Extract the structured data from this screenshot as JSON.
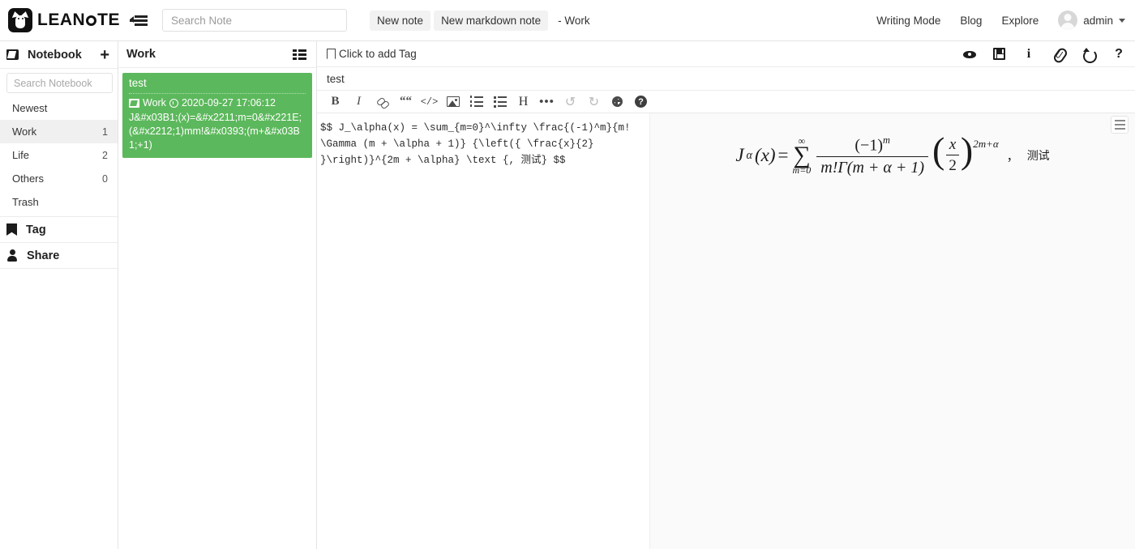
{
  "navbar": {
    "brand": "LEAN?TE",
    "brand_part1": "LEAN",
    "brand_part2": "TE",
    "collapse_icon": "collapse-sidebar-icon",
    "search_placeholder": "Search Note",
    "search_value": "",
    "new_note_label": "New note",
    "new_markdown_note_label": "New markdown note",
    "note_context": "- Work",
    "writing_mode_label": "Writing Mode",
    "blog_label": "Blog",
    "explore_label": "Explore",
    "user_name": "admin"
  },
  "sidebar": {
    "section_title": "Notebook",
    "add_label": "+",
    "search_placeholder": "Search Notebook",
    "search_value": "",
    "items": [
      {
        "label": "Newest",
        "count": ""
      },
      {
        "label": "Work",
        "count": "1"
      },
      {
        "label": "Life",
        "count": "2"
      },
      {
        "label": "Others",
        "count": "0"
      },
      {
        "label": "Trash",
        "count": ""
      }
    ],
    "footer_items": [
      {
        "label": "Tag",
        "icon": "bookmark-icon"
      },
      {
        "label": "Share",
        "icon": "person-icon"
      }
    ]
  },
  "notelist": {
    "title": "Work",
    "view_toggle_icon": "list-view-icon",
    "notes": [
      {
        "title": "test",
        "notebook": "Work",
        "datetime": "2020-09-27 17:06:12",
        "preview": "J&#x03B1;(x)=&#x2211;m=0&#x221E;(&#x2212;1)mm!&#x0393;(m+&#x03B1;+1)",
        "selected": true
      }
    ]
  },
  "editor": {
    "tag_placeholder": "Click to add Tag",
    "note_title": "test",
    "toolbar": [
      {
        "name": "bold",
        "label": "B"
      },
      {
        "name": "italic",
        "label": "I"
      },
      {
        "name": "link",
        "label": ""
      },
      {
        "name": "quote",
        "label": "““"
      },
      {
        "name": "code",
        "label": "</>"
      },
      {
        "name": "image",
        "label": ""
      },
      {
        "name": "ordered-list",
        "label": ""
      },
      {
        "name": "unordered-list",
        "label": ""
      },
      {
        "name": "heading",
        "label": "H"
      },
      {
        "name": "more",
        "label": "•••"
      },
      {
        "name": "undo",
        "label": "↺"
      },
      {
        "name": "redo",
        "label": "↻"
      },
      {
        "name": "settings",
        "label": ""
      },
      {
        "name": "help",
        "label": "?"
      }
    ],
    "right_tools": [
      {
        "name": "preview-eye-icon"
      },
      {
        "name": "save-icon"
      },
      {
        "name": "info-icon"
      },
      {
        "name": "attachment-icon"
      },
      {
        "name": "history-icon"
      },
      {
        "name": "help-icon"
      }
    ],
    "source": "$$ J_\\alpha(x) = \\sum_{m=0}^\\infty \\frac{(-1)^m}{m!\n\\Gamma (m + \\alpha + 1)} {\\left({ \\frac{x}{2}\n}\\right)}^{2m + \\alpha} \\text {, 测试} $$",
    "splitter_icon": "chevron-right-icon"
  },
  "preview": {
    "menu_icon": "preview-menu-icon",
    "formula_latex": "J_\\alpha(x) = \\sum_{m=0}^\\infty \\frac{(-1)^m}{m!\\Gamma(m+\\alpha+1)}\\left(\\frac{x}{2}\\right)^{2m+\\alpha}",
    "parts": {
      "J": "J",
      "alpha": "α",
      "open_x": "(x)",
      "equals": "=",
      "sum_top": "∞",
      "sum_sigma": "∑",
      "sum_bottom": "m=0",
      "numerator": "(−1)",
      "numerator_exp": "m",
      "denominator": "m!Γ(m + α + 1)",
      "paren_open": "(",
      "paren_close": ")",
      "frac_num": "x",
      "frac_den": "2",
      "outer_exp": "2m+α",
      "comma": "，",
      "cjk_text": "测试"
    }
  },
  "colors": {
    "accent_green": "#5cb85c",
    "border": "#e4e4e4",
    "sidebar_active": "#f0f0f0",
    "preview_bg": "#fafafa",
    "text": "#333333"
  }
}
